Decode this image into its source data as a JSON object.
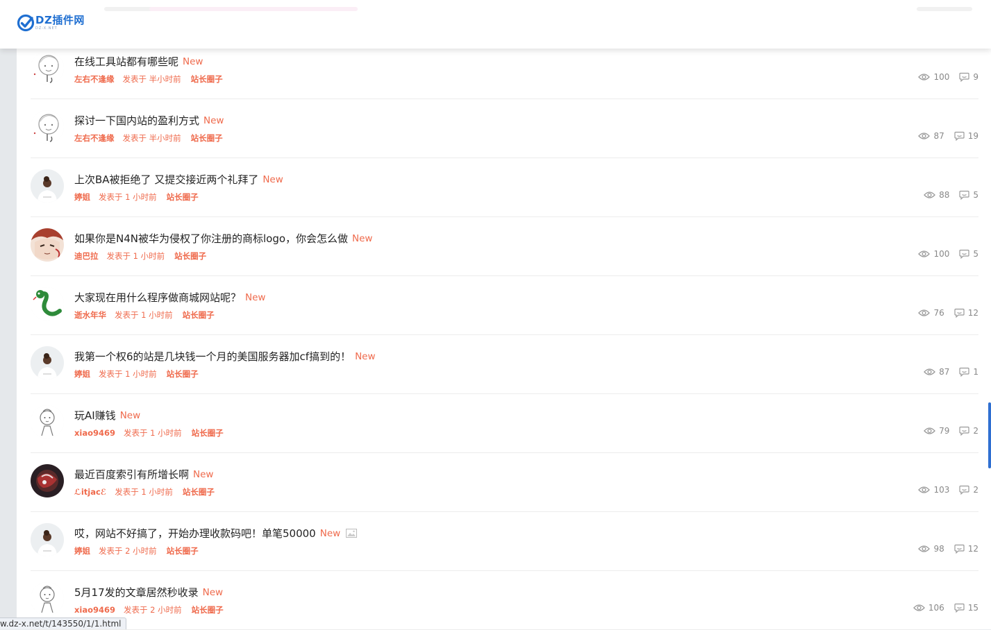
{
  "site": {
    "logo_text": "DZ插件网",
    "logo_sub": "DZ-X.NET"
  },
  "status_url": "w.dz-x.net/t/143550/1/1.html",
  "new_label": "New",
  "threads": [
    {
      "title": "在线工具站都有哪些呢",
      "author": "左右不逢缘",
      "posted": "发表于 半小时前",
      "forum": "站长圈子",
      "views": "100",
      "replies": "9",
      "avatar": "sketch",
      "has_image": false
    },
    {
      "title": "探讨一下国内站的盈利方式",
      "author": "左右不逢缘",
      "posted": "发表于 半小时前",
      "forum": "站长圈子",
      "views": "87",
      "replies": "19",
      "avatar": "sketch",
      "has_image": false
    },
    {
      "title": "上次BA被拒绝了 又提交接近两个礼拜了",
      "author": "婷姐",
      "posted": "发表于 1 小时前",
      "forum": "站长圈子",
      "views": "88",
      "replies": "5",
      "avatar": "person",
      "has_image": false
    },
    {
      "title": "如果你是N4N被华为侵权了你注册的商标logo，你会怎么做",
      "author": "迪巴拉",
      "posted": "发表于 1 小时前",
      "forum": "站长圈子",
      "views": "100",
      "replies": "5",
      "avatar": "anime",
      "has_image": false
    },
    {
      "title": "大家现在用什么程序做商城网站呢？",
      "author": "逝水年华",
      "posted": "发表于 1 小时前",
      "forum": "站长圈子",
      "views": "76",
      "replies": "12",
      "avatar": "snake",
      "has_image": false
    },
    {
      "title": "我第一个权6的站是几块钱一个月的美国服务器加cf搞到的！",
      "author": "婷姐",
      "posted": "发表于 1 小时前",
      "forum": "站长圈子",
      "views": "87",
      "replies": "1",
      "avatar": "person",
      "has_image": false
    },
    {
      "title": "玩AI赚钱",
      "author": "xiao9469",
      "posted": "发表于 1 小时前",
      "forum": "站长圈子",
      "views": "79",
      "replies": "2",
      "avatar": "doodle",
      "has_image": false
    },
    {
      "title": "最近百度索引有所增长啊",
      "author": "ℒitjacℰ",
      "posted": "发表于 1 小时前",
      "forum": "站长圈子",
      "views": "103",
      "replies": "2",
      "avatar": "dark",
      "has_image": false
    },
    {
      "title": "哎，网站不好搞了，开始办理收款码吧！单笔50000",
      "author": "婷姐",
      "posted": "发表于 2 小时前",
      "forum": "站长圈子",
      "views": "98",
      "replies": "12",
      "avatar": "person",
      "has_image": true
    },
    {
      "title": "5月17发的文章居然秒收录",
      "author": "xiao9469",
      "posted": "发表于 2 小时前",
      "forum": "站长圈子",
      "views": "106",
      "replies": "15",
      "avatar": "doodle",
      "has_image": false
    }
  ],
  "colors": {
    "accent": "#ef6a4c",
    "brand": "#1f6fd1",
    "text": "#222222",
    "muted": "#888888"
  }
}
